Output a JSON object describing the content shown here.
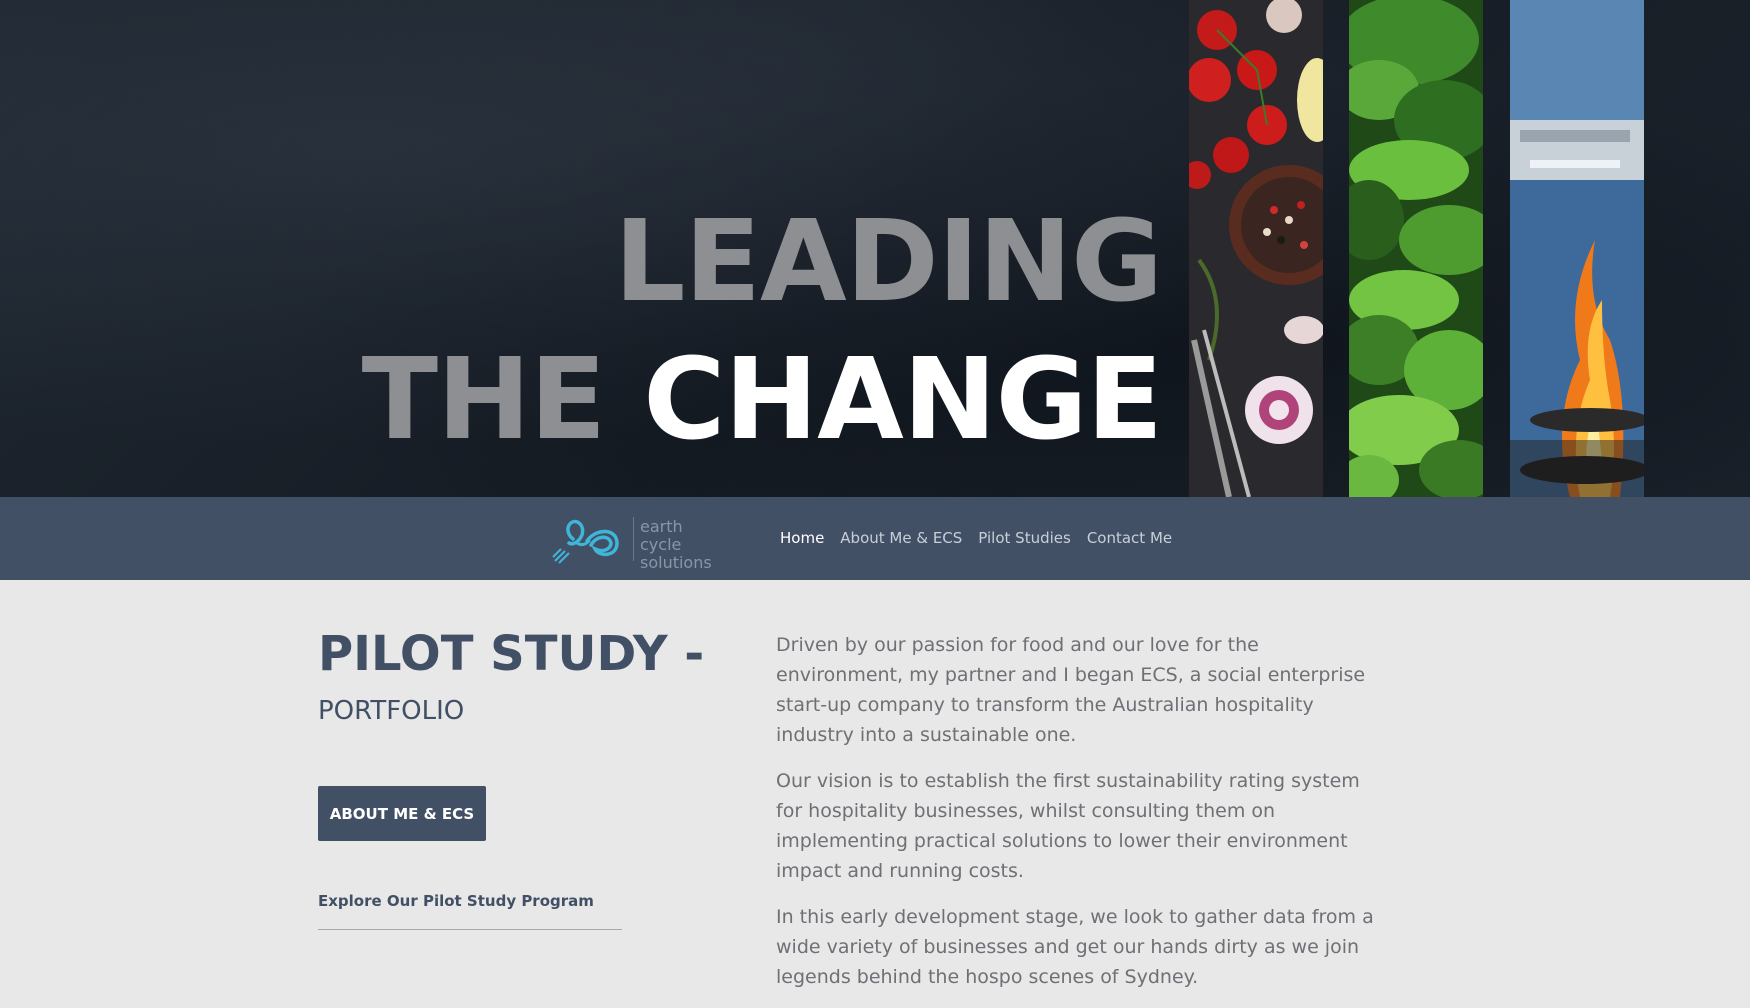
{
  "hero": {
    "line1": "LEADING",
    "line2_part1": "THE",
    "line2_part2": "CHANGE"
  },
  "nav": {
    "logo_line1": "earth cycle",
    "logo_line2": "solutions",
    "links": [
      {
        "label": "Home",
        "active": true
      },
      {
        "label": "About Me & ECS",
        "active": false
      },
      {
        "label": "Pilot Studies",
        "active": false
      },
      {
        "label": "Contact Me",
        "active": false
      }
    ]
  },
  "main": {
    "title": "PILOT STUDY -",
    "subtitle": "PORTFOLIO",
    "about_button": "ABOUT ME & ECS",
    "explore_link": "Explore Our Pilot Study Program",
    "paragraphs": [
      "Driven by our passion for food and our love for the environment, my partner and I began ECS, a social enterprise start-up company to transform the Australian hospitality industry into a sustainable one.",
      "Our vision is to establish the first sustainability rating system for hospitality businesses, whilst consulting them on implementing practical solutions to lower their environment impact and running costs.",
      "In this early development stage, we look to gather data from a wide variety of businesses and get our hands dirty as we join legends behind the hospo scenes of Sydney."
    ]
  },
  "colors": {
    "nav_bg": "#425066",
    "accent": "#425066",
    "logo_blue": "#3fb5d8",
    "page_bg": "#e8e8e8"
  }
}
